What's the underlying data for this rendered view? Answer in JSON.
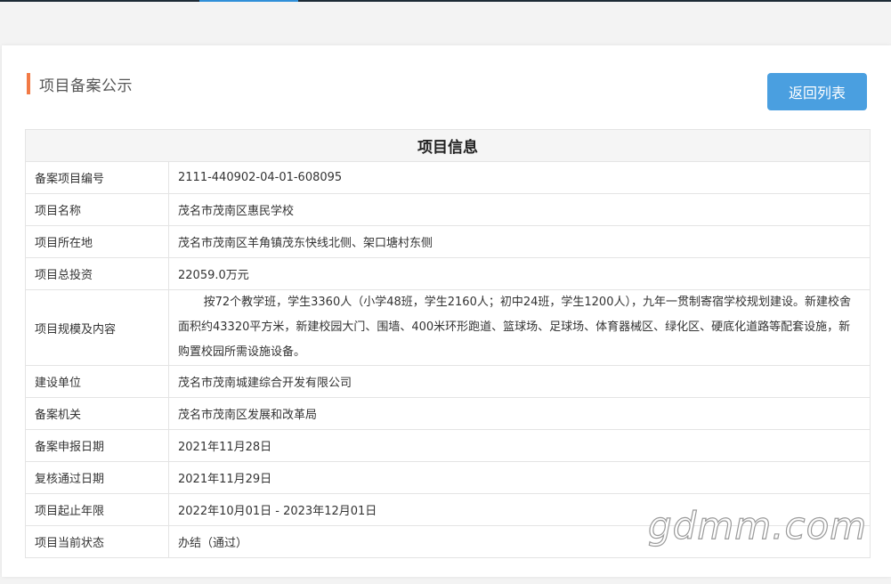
{
  "heading": {
    "title": "项目备案公示",
    "back_button": "返回列表",
    "accent_color": "#f27a45",
    "button_color": "#4a9fe0"
  },
  "table": {
    "caption": "项目信息",
    "rows": [
      {
        "label": "备案项目编号",
        "value": "2111-440902-04-01-608095"
      },
      {
        "label": "项目名称",
        "value": "茂名市茂南区惠民学校"
      },
      {
        "label": "项目所在地",
        "value": "茂名市茂南区羊角镇茂东快线北侧、架口塘村东侧"
      },
      {
        "label": "项目总投资",
        "value": "22059.0万元"
      },
      {
        "label": "项目规模及内容",
        "value": "按72个教学班，学生3360人（小学48班，学生2160人；初中24班，学生1200人），九年一贯制寄宿学校规划建设。新建校舍面积约43320平方米，新建校园大门、围墙、400米环形跑道、篮球场、足球场、体育器械区、绿化区、硬底化道路等配套设施，新购置校园所需设施设备。"
      },
      {
        "label": "建设单位",
        "value": "茂名市茂南城建综合开发有限公司"
      },
      {
        "label": "备案机关",
        "value": "茂名市茂南区发展和改革局"
      },
      {
        "label": "备案申报日期",
        "value": "2021年11月28日"
      },
      {
        "label": "复核通过日期",
        "value": "2021年11月29日"
      },
      {
        "label": "项目起止年限",
        "value": "2022年10月01日 - 2023年12月01日"
      },
      {
        "label": "项目当前状态",
        "value": "办结（通过）"
      }
    ]
  },
  "watermark": "gdmm.com"
}
